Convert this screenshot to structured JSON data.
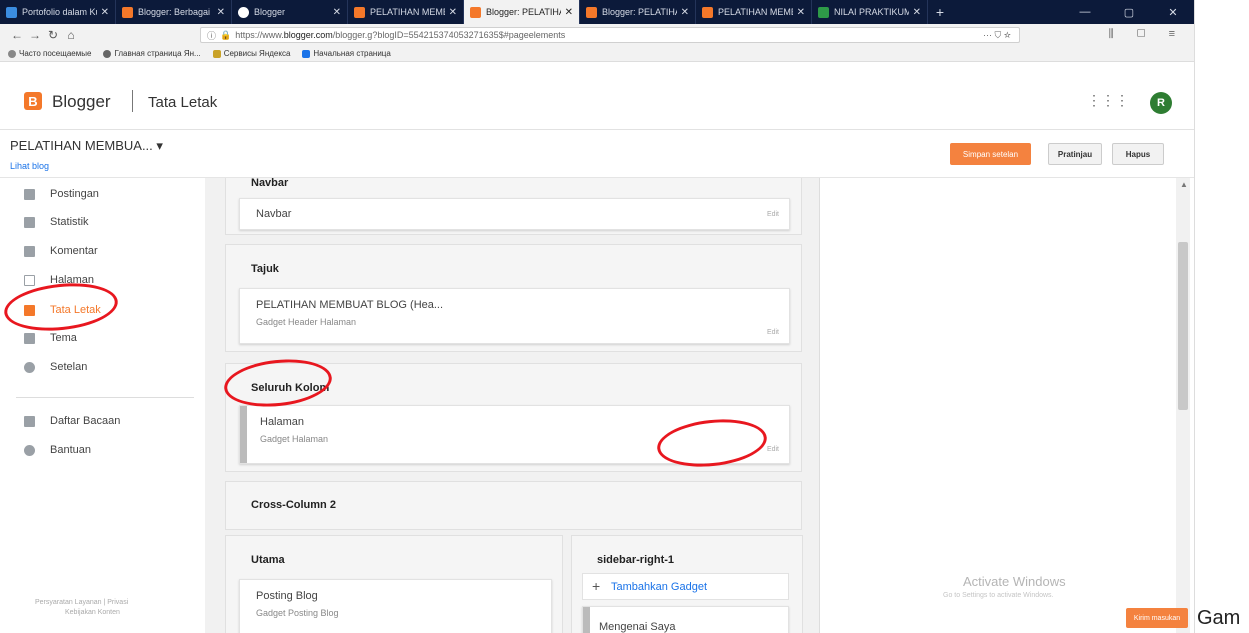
{
  "browser": {
    "tabs": [
      {
        "label": "Portofolio dalam Ku",
        "color": "#3b8de0"
      },
      {
        "label": "Blogger: Berbagai I",
        "color": "#f4782a"
      },
      {
        "label": "Blogger",
        "color": "#ffffff"
      },
      {
        "label": "PELATIHAN MEMBU",
        "color": "#f4782a"
      },
      {
        "label": "Blogger: PELATIHA",
        "color": "#f4782a",
        "active": true
      },
      {
        "label": "Blogger: PELATIHA",
        "color": "#f4782a"
      },
      {
        "label": "PELATIHAN MEMBU",
        "color": "#f4782a"
      },
      {
        "label": "NILAI PRAKTIKUM",
        "color": "#2e9a48"
      }
    ],
    "url_prefix": "https://www.",
    "url_domain": "blogger.com",
    "url_rest": "/blogger.g?blogID=554215374053271635$#pageelements",
    "url_icons": "··· ⛉ ☆",
    "nav_right": "⫼ ▢ ≡",
    "bookmarks": [
      "Часто посещаемые",
      "Главная страница Ян...",
      "Сервисы Яндекса",
      "Начальная страница"
    ]
  },
  "header": {
    "logo_letter": "B",
    "app_name": "Blogger",
    "page_name": "Tata Letak",
    "avatar_letter": "R",
    "apps_icon": "⋮⋮⋮"
  },
  "subbar": {
    "blog_title": "PELATIHAN MEMBUA... ▾",
    "view_blog": "Lihat blog",
    "save_button": "Simpan setelan",
    "preview_button": "Pratinjau",
    "delete_button": "Hapus"
  },
  "sidebar": {
    "items": [
      {
        "label": "Postingan"
      },
      {
        "label": "Statistik"
      },
      {
        "label": "Komentar"
      },
      {
        "label": "Halaman"
      },
      {
        "label": "Tata Letak"
      },
      {
        "label": "Tema"
      },
      {
        "label": "Setelan"
      },
      {
        "label": "Daftar Bacaan"
      },
      {
        "label": "Bantuan"
      }
    ],
    "footer_line1": "Persyaratan Layanan  |  Privasi",
    "footer_line2": "Kebijakan Konten"
  },
  "layout": {
    "navbar_section_title": "Navbar",
    "navbar_gadget": "Navbar",
    "tajuk_title": "Tajuk",
    "header_gadget_name": "PELATIHAN MEMBUAT BLOG (Hea...",
    "header_gadget_type": "Gadget Header Halaman",
    "seluruh_kolom_title": "Seluruh Kolom",
    "halaman_gadget_name": "Halaman",
    "halaman_gadget_type": "Gadget Halaman",
    "cross_column_title": "Cross-Column 2",
    "utama_title": "Utama",
    "posting_gadget_name": "Posting Blog",
    "posting_gadget_type": "Gadget Posting Blog",
    "sidebar_right_title": "sidebar-right-1",
    "add_gadget": "Tambahkan Gadget",
    "about_me_gadget": "Mengenai Saya",
    "edit_label": "Edit"
  },
  "overlay": {
    "watermark_title": "Activate Windows",
    "watermark_sub": "Go to Settings to activate Windows.",
    "feedback_button": "Kirim masukan"
  },
  "outside_text": "Gam"
}
